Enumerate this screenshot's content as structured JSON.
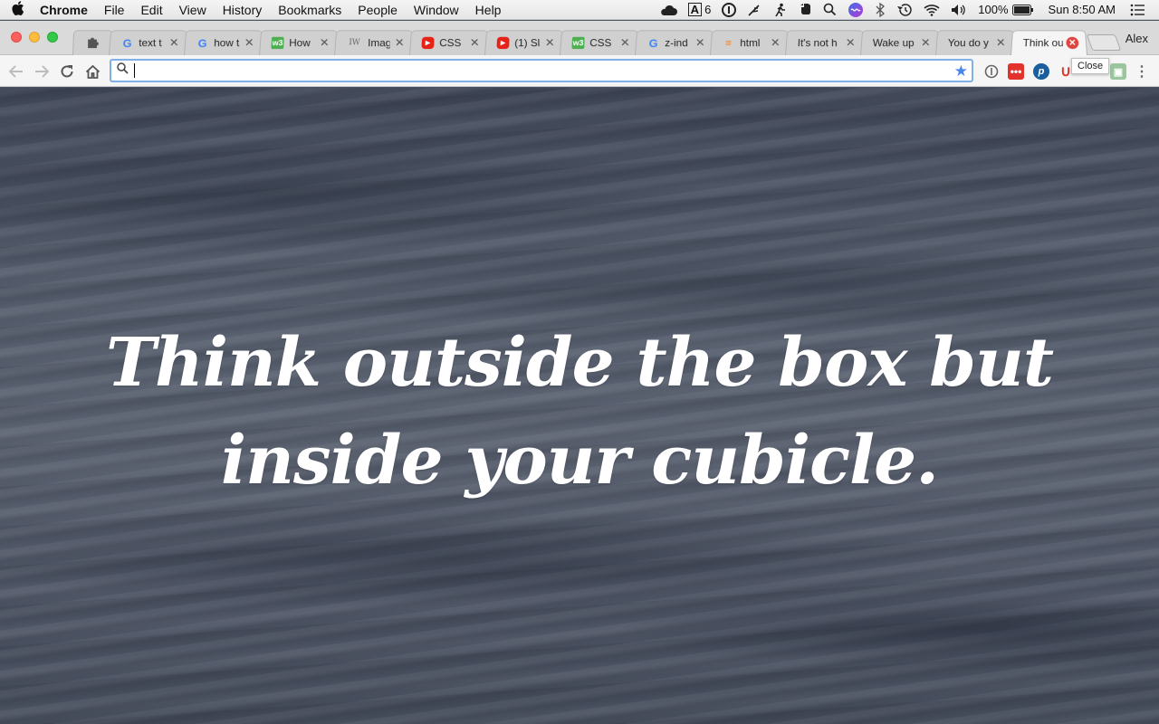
{
  "menubar": {
    "app_name": "Chrome",
    "items": [
      "File",
      "Edit",
      "View",
      "History",
      "Bookmarks",
      "People",
      "Window",
      "Help"
    ],
    "status": {
      "adobe_count": "6",
      "battery": "100%",
      "clock": "Sun 8:50 AM"
    }
  },
  "tabs": [
    {
      "title": "text t",
      "favicon": "google-icon",
      "active": false
    },
    {
      "title": "how t",
      "favicon": "google-icon",
      "active": false
    },
    {
      "title": "How",
      "favicon": "w3schools-icon",
      "active": false
    },
    {
      "title": "Imag",
      "favicon": "iw-icon",
      "active": false
    },
    {
      "title": "CSS I",
      "favicon": "youtube-icon",
      "active": false
    },
    {
      "title": "(1) Sl",
      "favicon": "youtube-icon",
      "active": false
    },
    {
      "title": "CSS",
      "favicon": "w3schools-icon",
      "active": false
    },
    {
      "title": "z-ind",
      "favicon": "google-icon",
      "active": false
    },
    {
      "title": "html",
      "favicon": "stackoverflow-icon",
      "active": false
    },
    {
      "title": "It's not h",
      "favicon": "",
      "active": false
    },
    {
      "title": "Wake up",
      "favicon": "",
      "active": false
    },
    {
      "title": "You do y",
      "favicon": "",
      "active": false
    },
    {
      "title": "Think ou",
      "favicon": "",
      "active": true
    }
  ],
  "profile_name": "Alex",
  "tooltip": "Close",
  "omnibox": {
    "value": "",
    "placeholder": ""
  },
  "content": {
    "quote": "Think outside the box but inside your cubicle."
  },
  "colors": {
    "accent_blue": "#4a86e8",
    "close_red": "#e0443e",
    "quote_text": "#ffffff"
  }
}
